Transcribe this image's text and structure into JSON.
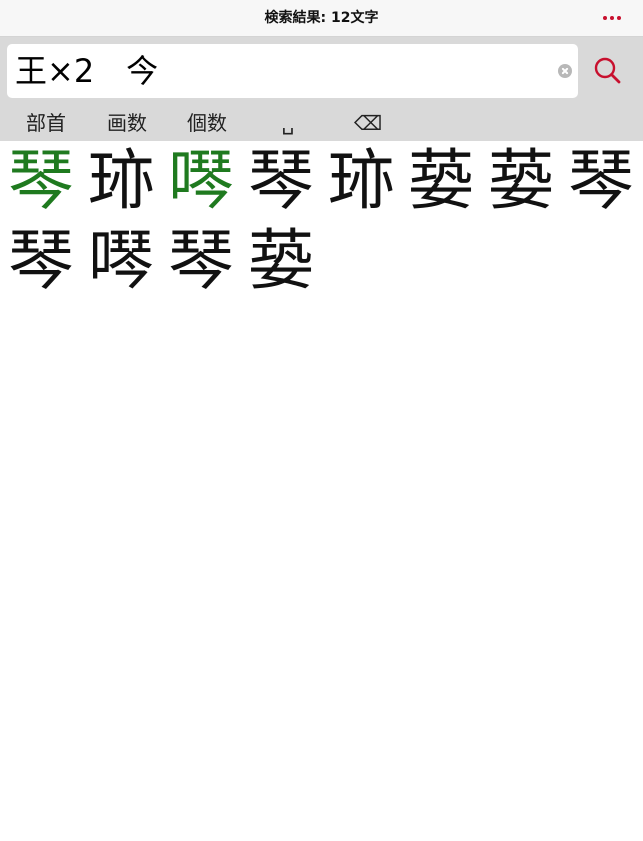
{
  "header": {
    "title": "検索結果: 12文字",
    "more_icon": "more-horizontal-icon",
    "accent_color": "#c8102e"
  },
  "search": {
    "query": "王×2　今",
    "clear_icon": "clear-icon",
    "search_icon": "search-icon"
  },
  "keys": {
    "radical": "部首",
    "strokes": "画数",
    "count": "個数",
    "space": "␣",
    "backspace": "⌫"
  },
  "results": {
    "highlight_color": "#1f7a1f",
    "items": [
      {
        "char": "琴",
        "highlight": true
      },
      {
        "char": "𤥂",
        "highlight": false
      },
      {
        "char": "噖",
        "highlight": true
      },
      {
        "char": "琴",
        "highlight": false
      },
      {
        "char": "𤥂",
        "highlight": false
      },
      {
        "char": "蒆",
        "highlight": false
      },
      {
        "char": "蒆",
        "highlight": false
      },
      {
        "char": "琴",
        "highlight": false
      },
      {
        "char": "琴",
        "highlight": false
      },
      {
        "char": "噖",
        "highlight": false
      },
      {
        "char": "琴",
        "highlight": false
      },
      {
        "char": "蒆",
        "highlight": false
      }
    ]
  }
}
